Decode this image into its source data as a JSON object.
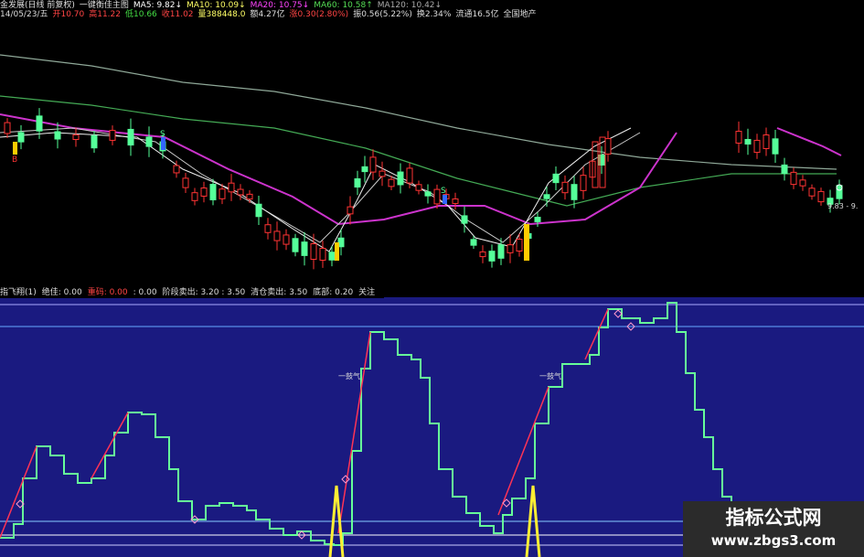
{
  "header": {
    "row1": [
      {
        "text": "金发展(日线 前复权)",
        "color": "#dddddd"
      },
      {
        "text": "一键衡佳主图",
        "color": "#dddddd"
      },
      {
        "text": "MA5: 9.82↓",
        "color": "#ffffff"
      },
      {
        "text": "MA10: 10.09↓",
        "color": "#ffff66"
      },
      {
        "text": "MA20: 10.75↓",
        "color": "#ff44ff"
      },
      {
        "text": "MA60: 10.58↑",
        "color": "#55dd55"
      },
      {
        "text": "MA120: 10.42↓",
        "color": "#aaaaaa"
      }
    ],
    "row2": [
      {
        "text": "14/05/23/五",
        "color": "#dddddd"
      },
      {
        "text": "开10.70",
        "color": "#ff4444"
      },
      {
        "text": "高11.22",
        "color": "#ff4444"
      },
      {
        "text": "低10.66",
        "color": "#44dd44"
      },
      {
        "text": "收11.02",
        "color": "#ff4444"
      },
      {
        "text": "量388448.0",
        "color": "#ffff66"
      },
      {
        "text": "额4.27亿",
        "color": "#dddddd"
      },
      {
        "text": "涨0.30(2.80%)",
        "color": "#ff4444"
      },
      {
        "text": "振0.56(5.22%)",
        "color": "#dddddd"
      },
      {
        "text": "换2.34%",
        "color": "#dddddd"
      },
      {
        "text": "流通16.5亿",
        "color": "#dddddd"
      },
      {
        "text": "全国地产",
        "color": "#dddddd"
      }
    ]
  },
  "main_chart": {
    "marker_s1": "S",
    "marker_s2": "S",
    "marker_b": "B",
    "price_label": "9.83 - 9."
  },
  "oscillator": {
    "labels": [
      {
        "text": "指飞翔(1)",
        "color": "#dddddd"
      },
      {
        "text": "绝佳: 0.00",
        "color": "#dddddd"
      },
      {
        "text": "重码: 0.00",
        "color": "#ff4444"
      },
      {
        "text": ": 0.00",
        "color": "#dddddd"
      },
      {
        "text": "阶段卖出: 3.20 : 3.50",
        "color": "#dddddd"
      },
      {
        "text": "清仓卖出: 3.50",
        "color": "#dddddd"
      },
      {
        "text": "底部: 0.20",
        "color": "#dddddd"
      },
      {
        "text": "关注",
        "color": "#dddddd"
      }
    ],
    "annotation1": "一鼓气",
    "annotation2": "一鼓气"
  },
  "watermark": {
    "title": "指标公式网",
    "url": "www.zbgs3.com"
  },
  "colors": {
    "background": "#000000",
    "osc_background": "#1a1a80",
    "rise": "#ff3333",
    "fall": "#55ff99",
    "ma5": "#ffffff",
    "ma10": "#ffff66",
    "ma20": "#cc33cc",
    "ma60": "#44aa55",
    "ma120": "#aaaaaa"
  }
}
